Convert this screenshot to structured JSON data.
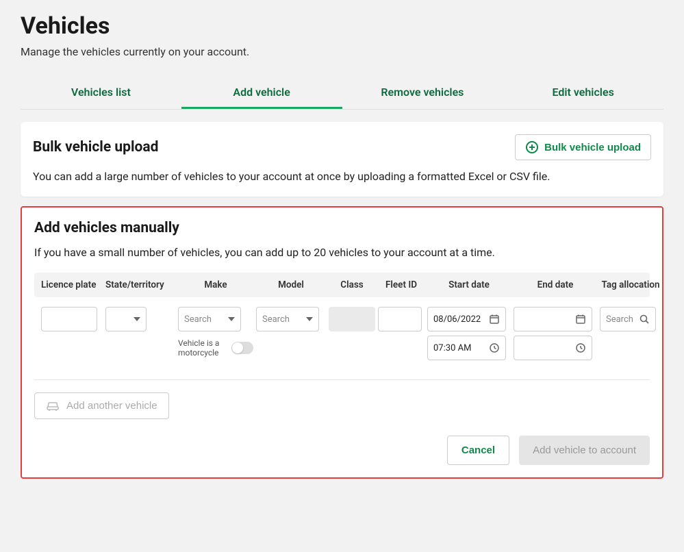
{
  "page": {
    "title": "Vehicles",
    "subtitle": "Manage the vehicles currently on your account."
  },
  "tabs": [
    {
      "label": "Vehicles list",
      "active": false
    },
    {
      "label": "Add vehicle",
      "active": true
    },
    {
      "label": "Remove vehicles",
      "active": false
    },
    {
      "label": "Edit vehicles",
      "active": false
    }
  ],
  "bulk": {
    "title": "Bulk vehicle upload",
    "button": "Bulk vehicle upload",
    "desc": "You can add a large number of vehicles to your account at once by uploading a formatted Excel or CSV file."
  },
  "manual": {
    "title": "Add vehicles manually",
    "desc": "If you have a small number of vehicles, you can add up to 20 vehicles to your account at a time.",
    "columns": {
      "licence_plate": "Licence plate",
      "state": "State/territory",
      "make": "Make",
      "model": "Model",
      "class": "Class",
      "fleet_id": "Fleet ID",
      "start_date": "Start date",
      "end_date": "End date",
      "tag": "Tag allocation"
    },
    "row": {
      "make_placeholder": "Search",
      "model_placeholder": "Search",
      "motorcycle_label": "Vehicle is a motorcycle",
      "start_date": "08/06/2022",
      "start_time": "07:30 AM",
      "tag_placeholder": "Search"
    },
    "add_another": "Add another vehicle",
    "cancel": "Cancel",
    "submit": "Add vehicle to account"
  }
}
